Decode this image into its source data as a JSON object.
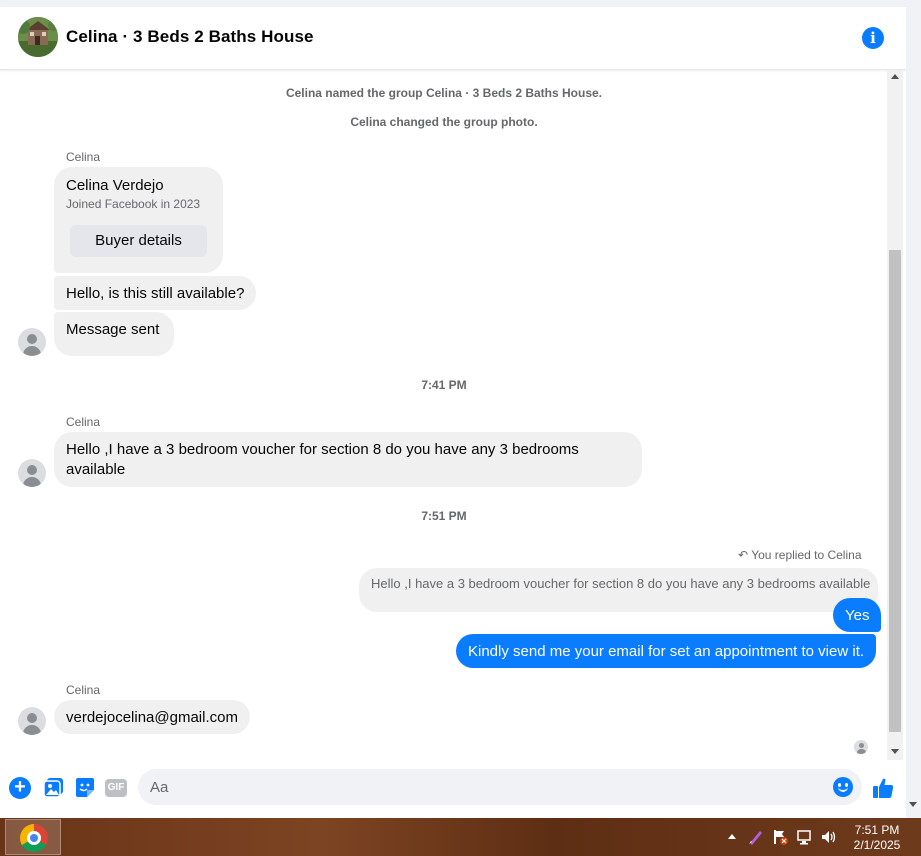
{
  "header": {
    "title": "Celina · 3 Beds 2 Baths House"
  },
  "system_messages": [
    "Celina named the group Celina · 3 Beds 2 Baths House.",
    "Celina changed the group photo."
  ],
  "profile_card": {
    "sender": "Celina",
    "name": "Celina Verdejo",
    "subtitle": "Joined Facebook in 2023",
    "button_label": "Buyer details"
  },
  "messages": {
    "m1": "Hello, is this still available?",
    "m2": "Message sent",
    "ts1": "7:41 PM",
    "sender2": "Celina",
    "m3": "Hello ,I have a 3 bedroom voucher for section 8 do you have any 3 bedrooms available",
    "ts2": "7:51 PM",
    "replied_label": "You replied to Celina",
    "reply_quote": "Hello ,I have a 3 bedroom voucher for section 8 do you have any 3 bedrooms available",
    "out1": "Yes",
    "out2": "Kindly send me your email for set an appointment to view it.",
    "sender3": "Celina",
    "m4": "verdejocelina@gmail.com"
  },
  "composer": {
    "placeholder": "Aa",
    "gif_label": "GIF"
  },
  "taskbar": {
    "time": "7:51 PM",
    "date": "2/1/2025"
  },
  "colors": {
    "accent": "#0a7cff",
    "bubble_in": "#f0f0f0",
    "taskbar": "#6a3418"
  }
}
